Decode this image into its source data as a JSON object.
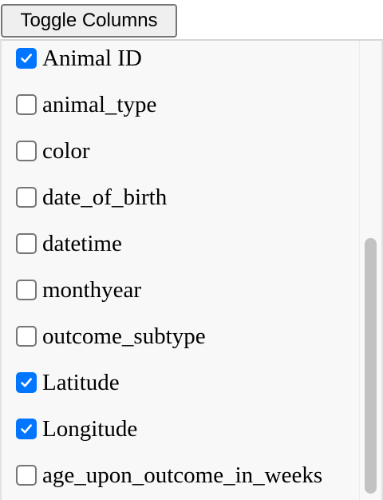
{
  "toolbar": {
    "toggle_label": "Toggle Columns"
  },
  "columns": [
    {
      "label": "Animal ID",
      "checked": true
    },
    {
      "label": "animal_type",
      "checked": false
    },
    {
      "label": "color",
      "checked": false
    },
    {
      "label": "date_of_birth",
      "checked": false
    },
    {
      "label": "datetime",
      "checked": false
    },
    {
      "label": "monthyear",
      "checked": false
    },
    {
      "label": "outcome_subtype",
      "checked": false
    },
    {
      "label": "Latitude",
      "checked": true
    },
    {
      "label": "Longitude",
      "checked": true
    },
    {
      "label": "age_upon_outcome_in_weeks",
      "checked": false
    }
  ],
  "colors": {
    "checkbox_checked": "#0075ff",
    "scrollbar_thumb": "#c2c2c2"
  }
}
